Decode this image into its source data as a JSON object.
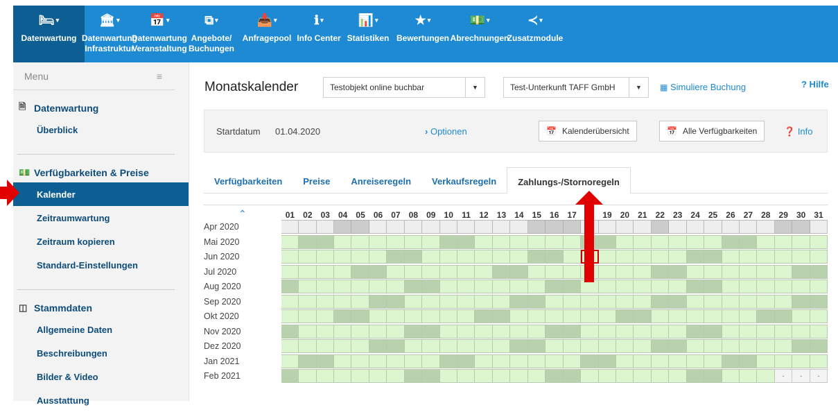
{
  "nav": [
    {
      "label": "Datenwartung",
      "sub": "",
      "icon": "bed-icon",
      "glyph": "🛏",
      "active": true
    },
    {
      "label": "Datenwartung",
      "sub": "Infrastruktur",
      "icon": "building-icon",
      "glyph": "🏛",
      "active": false
    },
    {
      "label": "Datenwartung",
      "sub": "Veranstaltung",
      "icon": "calendar-icon",
      "glyph": "📅",
      "active": false
    },
    {
      "label": "Angebote/",
      "sub": "Buchungen",
      "icon": "offers-icon",
      "glyph": "⧉",
      "active": false
    },
    {
      "label": "Anfragepool",
      "sub": "",
      "icon": "inbox-icon",
      "glyph": "📥",
      "active": false
    },
    {
      "label": "Info Center",
      "sub": "",
      "icon": "info-icon",
      "glyph": "ℹ",
      "active": false
    },
    {
      "label": "Statistiken",
      "sub": "",
      "icon": "bar-chart-icon",
      "glyph": "📊",
      "active": false
    },
    {
      "label": "Bewertungen",
      "sub": "",
      "icon": "star-icon",
      "glyph": "★",
      "active": false
    },
    {
      "label": "Abrechnungen",
      "sub": "",
      "icon": "money-icon",
      "glyph": "💵",
      "active": false
    },
    {
      "label": "Zusatzmodule",
      "sub": "",
      "icon": "share-icon",
      "glyph": "≺",
      "active": false
    }
  ],
  "sidebar": {
    "menu_label": "Menu",
    "sections": [
      {
        "title": "Datenwartung",
        "icon": "document-icon",
        "glyph": "🗎",
        "items": [
          "Überblick"
        ],
        "active": -1
      },
      {
        "title": "Verfügbarkeiten & Preise",
        "icon": "money-icon",
        "glyph": "💵",
        "items": [
          "Kalender",
          "Zeitraumwartung",
          "Zeitraum kopieren",
          "Standard-Einstellungen"
        ],
        "active": 0
      },
      {
        "title": "Stammdaten",
        "icon": "columns-icon",
        "glyph": "◫",
        "items": [
          "Allgemeine Daten",
          "Beschreibungen",
          "Bilder & Video",
          "Ausstattung"
        ],
        "active": -1
      }
    ]
  },
  "page": {
    "title": "Monatskalender",
    "object_select": "Testobjekt online buchbar",
    "company_select": "Test-Unterkunft TAFF GmbH",
    "simulate_link": "Simuliere Buchung",
    "help_link": "? Hilfe",
    "start_label": "Startdatum",
    "start_value": "01.04.2020",
    "options_link": "Optionen",
    "calendar_overview_btn": "Kalenderübersicht",
    "all_availability_btn": "Alle Verfügbarkeiten",
    "info_link": "Info"
  },
  "tabs": [
    "Verfügbarkeiten",
    "Preise",
    "Anreiseregeln",
    "Verkaufsregeln",
    "Zahlungs-/Stornoregeln"
  ],
  "active_tab": 4,
  "calendar": {
    "days": [
      "01",
      "02",
      "03",
      "04",
      "05",
      "06",
      "07",
      "08",
      "09",
      "10",
      "11",
      "12",
      "13",
      "14",
      "15",
      "16",
      "17",
      "18",
      "19",
      "20",
      "21",
      "22",
      "23",
      "24",
      "25",
      "26",
      "27",
      "28",
      "29",
      "30",
      "31"
    ],
    "months": [
      {
        "label": "Apr 2020",
        "cells": "cccddcccccccccdddccccdccccccddcax"
      },
      {
        "label": "Mai 2020",
        "cells": "abbaaaaaabbaaaaaabbaaaaaabbaaaaab"
      },
      {
        "label": "Jun 2020",
        "cells": "aaaaaabbaaaaaabbaaaaaaabbaaaaaabx"
      },
      {
        "label": "Jul 2020",
        "cells": "aaaabbaaaaaabbaaaaaaabbaaaaaabbaa"
      },
      {
        "label": "Aug 2020",
        "cells": "baaaaaabbaaaaaabbaaaaaabbaaaaaabb"
      },
      {
        "label": "Sep 2020",
        "cells": "aaaaabbaaaaaabbaaaaaabbaaaaaabbax"
      },
      {
        "label": "Okt 2020",
        "cells": "aaabbaaaaaabbaaaaaabbaaaaaabbaaab"
      },
      {
        "label": "Nov 2020",
        "cells": "baaaaaabbaaaaaabbaaaaaabbaaaaaabx"
      },
      {
        "label": "Dez 2020",
        "cells": "aaaaabbaaaaaabbaaaaaabbaaaaaabbaa"
      },
      {
        "label": "Jan 2021",
        "cells": "abbaaaaaabbaaaaaabbaaaaaabbaaaaab"
      },
      {
        "label": "Feb 2021",
        "cells": "baaaaaabbaaaaaabbaaaaaabbaaaxxx"
      }
    ]
  },
  "colors": {
    "nav_bg": "#1d8ad3",
    "nav_active": "#0c5e93",
    "free": "#ddf6cf",
    "weekend": "#bad1ae",
    "marker": "#e00000"
  }
}
